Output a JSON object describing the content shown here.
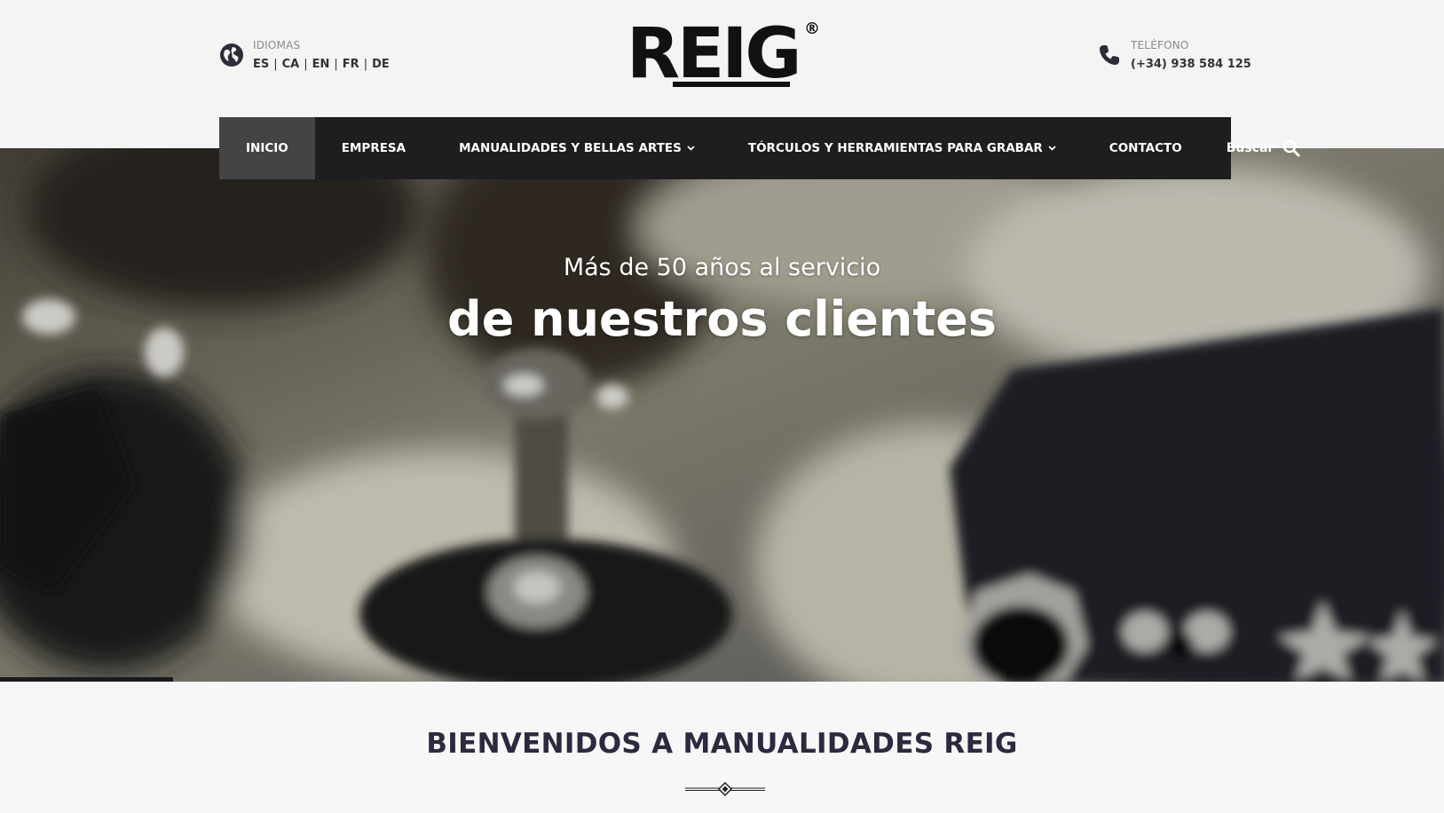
{
  "header": {
    "languages": {
      "label": "IDIOMAS",
      "items": [
        "ES",
        "CA",
        "EN",
        "FR",
        "DE"
      ],
      "separator": "|"
    },
    "logo": {
      "text": "REIG",
      "registered": "®"
    },
    "phone": {
      "label": "TELÉFONO",
      "number": "(+34) 938 584 125"
    }
  },
  "nav": {
    "items": [
      {
        "label": "INICIO",
        "active": true,
        "dropdown": false
      },
      {
        "label": "EMPRESA",
        "active": false,
        "dropdown": false
      },
      {
        "label": "MANUALIDADES Y BELLAS ARTES",
        "active": false,
        "dropdown": true
      },
      {
        "label": "TÓRCULOS Y HERRAMIENTAS PARA GRABAR",
        "active": false,
        "dropdown": true
      },
      {
        "label": "CONTACTO",
        "active": false,
        "dropdown": false
      }
    ],
    "search_label": "Buscar"
  },
  "hero": {
    "subtitle": "Más de 50 años al servicio",
    "title": "de nuestros clientes",
    "slider_progress": 0.12
  },
  "welcome": {
    "title": "BIENVENIDOS A MANUALIDADES REIG"
  },
  "icons": {
    "globe": "globe-icon",
    "phone": "phone-icon",
    "search": "search-icon",
    "caret": "chevron-down-icon",
    "divider": "diamond-divider-icon"
  },
  "colors": {
    "nav_bg": "#1e1e1e",
    "nav_active": "#444444",
    "title_color": "#2b2a3f",
    "page_bg": "#f4f4f4"
  }
}
